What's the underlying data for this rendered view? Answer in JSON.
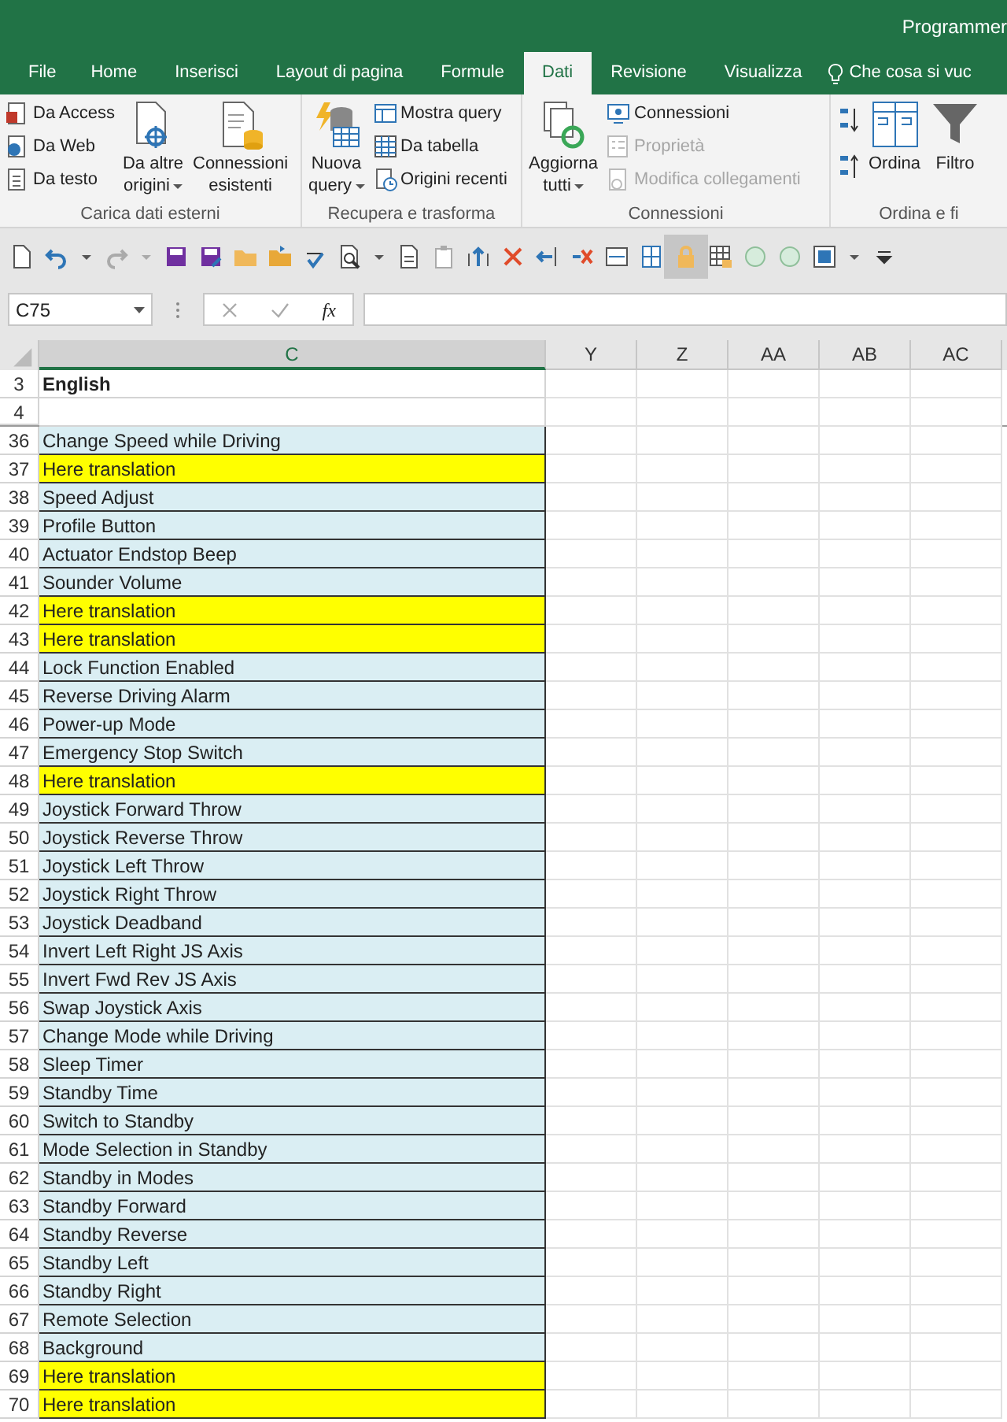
{
  "window": {
    "title": "Programmer"
  },
  "tabs": [
    {
      "label": "File",
      "selected": false
    },
    {
      "label": "Home",
      "selected": false
    },
    {
      "label": "Inserisci",
      "selected": false
    },
    {
      "label": "Layout di pagina",
      "selected": false
    },
    {
      "label": "Formule",
      "selected": false
    },
    {
      "label": "Dati",
      "selected": true
    },
    {
      "label": "Revisione",
      "selected": false
    },
    {
      "label": "Visualizza",
      "selected": false
    }
  ],
  "tell_me": {
    "placeholder": "Che cosa si vuc"
  },
  "ribbon": {
    "groups": [
      {
        "label": "Carica dati esterni",
        "buttons": [
          {
            "kind": "small",
            "label": "Da Access",
            "disabled": false
          },
          {
            "kind": "small",
            "label": "Da Web",
            "disabled": false
          },
          {
            "kind": "small",
            "label": "Da testo",
            "disabled": false
          },
          {
            "kind": "large",
            "label": "Da altre\norigini",
            "dropdown": true
          },
          {
            "kind": "large",
            "label": "Connessioni\nesistenti",
            "dropdown": false
          }
        ]
      },
      {
        "label": "Recupera e trasforma",
        "buttons": [
          {
            "kind": "large",
            "label": "Nuova\nquery",
            "dropdown": true
          },
          {
            "kind": "small",
            "label": "Mostra query",
            "disabled": false
          },
          {
            "kind": "small",
            "label": "Da tabella",
            "disabled": false
          },
          {
            "kind": "small",
            "label": "Origini recenti",
            "disabled": false
          }
        ]
      },
      {
        "label": "Connessioni",
        "buttons": [
          {
            "kind": "large",
            "label": "Aggiorna\ntutti",
            "dropdown": true
          },
          {
            "kind": "small",
            "label": "Connessioni",
            "disabled": false
          },
          {
            "kind": "small",
            "label": "Proprietà",
            "disabled": true
          },
          {
            "kind": "small",
            "label": "Modifica collegamenti",
            "disabled": true
          }
        ]
      },
      {
        "label": "Ordina e fi",
        "buttons": [
          {
            "kind": "sort"
          },
          {
            "kind": "large",
            "label": "Ordina",
            "dropdown": false
          },
          {
            "kind": "large",
            "label": "Filtro",
            "dropdown": false
          }
        ]
      }
    ]
  },
  "formula_bar": {
    "name_box": "C75",
    "fx": "fx"
  },
  "columns": [
    {
      "label": "C",
      "selected": true
    },
    {
      "label": "Y",
      "selected": false
    },
    {
      "label": "Z",
      "selected": false
    },
    {
      "label": "AA",
      "selected": false
    },
    {
      "label": "AB",
      "selected": false
    },
    {
      "label": "AC",
      "selected": false
    }
  ],
  "frozen_rows": [
    {
      "number": "3",
      "text": "English",
      "bold": true,
      "color": "#ffffff"
    },
    {
      "number": "4",
      "color": "#ffffff"
    }
  ],
  "rows": [
    {
      "number": "36",
      "text": "Change Speed while Driving",
      "bold": false,
      "color": "#daeef3"
    },
    {
      "number": "37",
      "text": "Here translation",
      "bold": false,
      "color": "#ffff00"
    },
    {
      "number": "38",
      "text": "Speed Adjust",
      "bold": false,
      "color": "#daeef3"
    },
    {
      "number": "39",
      "text": "Profile Button",
      "bold": false,
      "color": "#daeef3"
    },
    {
      "number": "40",
      "text": "Actuator Endstop Beep",
      "bold": false,
      "color": "#daeef3"
    },
    {
      "number": "41",
      "text": "Sounder Volume",
      "bold": false,
      "color": "#daeef3"
    },
    {
      "number": "42",
      "text": "Here translation",
      "bold": false,
      "color": "#ffff00"
    },
    {
      "number": "43",
      "text": "Here translation",
      "bold": false,
      "color": "#ffff00"
    },
    {
      "number": "44",
      "text": "Lock Function Enabled",
      "bold": false,
      "color": "#daeef3"
    },
    {
      "number": "45",
      "text": "Reverse Driving Alarm",
      "bold": false,
      "color": "#daeef3"
    },
    {
      "number": "46",
      "text": "Power-up Mode",
      "bold": false,
      "color": "#daeef3"
    },
    {
      "number": "47",
      "text": "Emergency Stop Switch",
      "bold": false,
      "color": "#daeef3"
    },
    {
      "number": "48",
      "text": "Here translation",
      "bold": false,
      "color": "#ffff00"
    },
    {
      "number": "49",
      "text": "Joystick Forward Throw",
      "bold": false,
      "color": "#daeef3"
    },
    {
      "number": "50",
      "text": "Joystick Reverse Throw",
      "bold": false,
      "color": "#daeef3"
    },
    {
      "number": "51",
      "text": "Joystick Left Throw",
      "bold": false,
      "color": "#daeef3"
    },
    {
      "number": "52",
      "text": "Joystick Right Throw",
      "bold": false,
      "color": "#daeef3"
    },
    {
      "number": "53",
      "text": "Joystick Deadband",
      "bold": false,
      "color": "#daeef3"
    },
    {
      "number": "54",
      "text": "Invert Left Right JS Axis",
      "bold": false,
      "color": "#daeef3"
    },
    {
      "number": "55",
      "text": "Invert Fwd Rev JS Axis",
      "bold": false,
      "color": "#daeef3"
    },
    {
      "number": "56",
      "text": "Swap Joystick Axis",
      "bold": false,
      "color": "#daeef3"
    },
    {
      "number": "57",
      "text": "Change Mode while Driving",
      "bold": false,
      "color": "#daeef3"
    },
    {
      "number": "58",
      "text": "Sleep Timer",
      "bold": false,
      "color": "#daeef3"
    },
    {
      "number": "59",
      "text": "Standby Time",
      "bold": false,
      "color": "#daeef3"
    },
    {
      "number": "60",
      "text": "Switch to Standby",
      "bold": false,
      "color": "#daeef3"
    },
    {
      "number": "61",
      "text": "Mode Selection in Standby",
      "bold": false,
      "color": "#daeef3"
    },
    {
      "number": "62",
      "text": "Standby in Modes",
      "bold": false,
      "color": "#daeef3"
    },
    {
      "number": "63",
      "text": "Standby Forward",
      "bold": false,
      "color": "#daeef3"
    },
    {
      "number": "64",
      "text": "Standby Reverse",
      "bold": false,
      "color": "#daeef3"
    },
    {
      "number": "65",
      "text": "Standby Left",
      "bold": false,
      "color": "#daeef3"
    },
    {
      "number": "66",
      "text": "Standby Right",
      "bold": false,
      "color": "#daeef3"
    },
    {
      "number": "67",
      "text": "Remote Selection",
      "bold": false,
      "color": "#daeef3"
    },
    {
      "number": "68",
      "text": "Background",
      "bold": false,
      "color": "#daeef3"
    },
    {
      "number": "69",
      "text": "Here translation",
      "bold": false,
      "color": "#ffff00"
    },
    {
      "number": "70",
      "text": "Here translation",
      "bold": false,
      "color": "#ffff00"
    }
  ]
}
